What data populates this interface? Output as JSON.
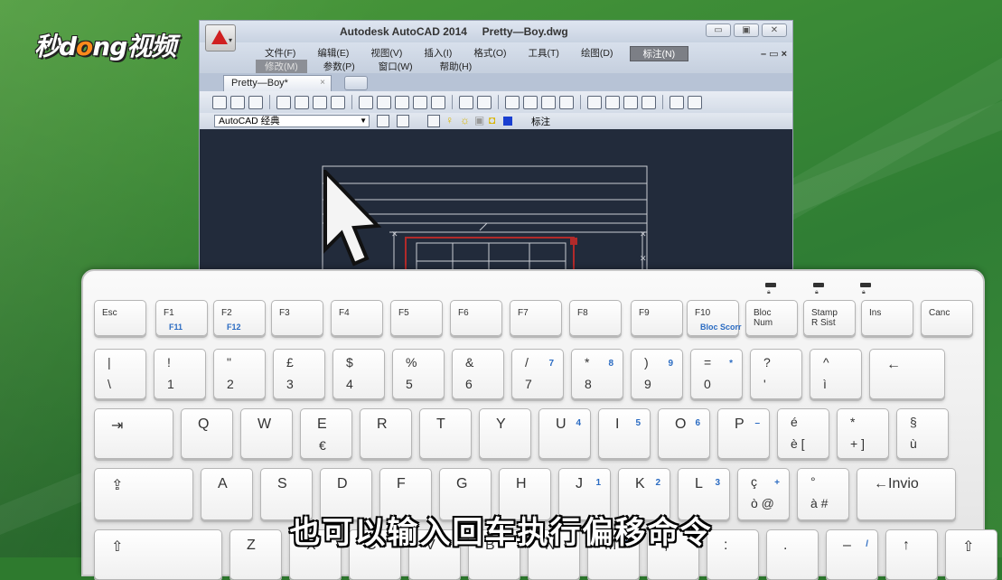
{
  "logo": {
    "text_pre": "秒d",
    "text_o": "o",
    "text_post": "ng视频"
  },
  "autocad": {
    "title": "Autodesk AutoCAD 2014     Pretty—Boy.dwg",
    "window_buttons": [
      "▭",
      "▣",
      "✕"
    ],
    "menu_row1": [
      "文件(F)",
      "编辑(E)",
      "视图(V)",
      "插入(I)",
      "格式(O)",
      "工具(T)",
      "绘图(D)",
      "标注(N)"
    ],
    "menu_row2": [
      "修改(M)",
      "参数(P)",
      "窗口(W)",
      "帮助(H)"
    ],
    "mdi_controls": "– ▭ ×",
    "doc_tab": "Pretty—Boy*",
    "doc_tab_close": "×",
    "workspace": "AutoCAD 经典",
    "layer_label": "标注"
  },
  "keyboard": {
    "row0": [
      {
        "main": "Esc"
      },
      {
        "main": "F1",
        "blue": "F11"
      },
      {
        "main": "F2",
        "blue": "F12"
      },
      {
        "main": "F3"
      },
      {
        "main": "F4"
      },
      {
        "main": "F5"
      },
      {
        "main": "F6"
      },
      {
        "main": "F7"
      },
      {
        "main": "F8"
      },
      {
        "main": "F9"
      },
      {
        "main": "F10",
        "blue": "Bloc Scorr"
      },
      {
        "main": "Bloc\nNum"
      },
      {
        "main": "Stamp\nR Sist"
      },
      {
        "main": "Ins"
      },
      {
        "main": "Canc"
      }
    ],
    "row1": [
      {
        "top": "|",
        "bottom": "\\"
      },
      {
        "top": "!",
        "bottom": "1"
      },
      {
        "top": "\"",
        "bottom": "2"
      },
      {
        "top": "£",
        "bottom": "3"
      },
      {
        "top": "$",
        "bottom": "4"
      },
      {
        "top": "%",
        "bottom": "5"
      },
      {
        "top": "&",
        "bottom": "6"
      },
      {
        "top": "/",
        "bottom": "7",
        "blue": "7"
      },
      {
        "top": "*",
        "bottom": "8",
        "blue": "8"
      },
      {
        "top": ")",
        "bottom": "9",
        "blue": "9"
      },
      {
        "top": "=",
        "bottom": "0",
        "blue": "*"
      },
      {
        "top": "?",
        "bottom": "'"
      },
      {
        "top": "^",
        "bottom": "ì"
      },
      {
        "main": "←"
      }
    ],
    "row2": [
      {
        "main": "⇥"
      },
      {
        "main": "Q"
      },
      {
        "main": "W"
      },
      {
        "main": "E",
        "sub": "€"
      },
      {
        "main": "R"
      },
      {
        "main": "T"
      },
      {
        "main": "Y"
      },
      {
        "main": "U",
        "blue": "4"
      },
      {
        "main": "I",
        "blue": "5"
      },
      {
        "main": "O",
        "blue": "6"
      },
      {
        "main": "P",
        "blue": "–"
      },
      {
        "top": "é",
        "bottom": "è  ["
      },
      {
        "top": "*",
        "bottom": "+  ]"
      },
      {
        "top": "§",
        "bottom": "ù"
      }
    ],
    "row3": [
      {
        "main": "⇪"
      },
      {
        "main": "A"
      },
      {
        "main": "S"
      },
      {
        "main": "D"
      },
      {
        "main": "F"
      },
      {
        "main": "G"
      },
      {
        "main": "H"
      },
      {
        "main": "J",
        "blue": "1"
      },
      {
        "main": "K",
        "blue": "2"
      },
      {
        "main": "L",
        "blue": "3"
      },
      {
        "top": "ç",
        "bottom": "ò  @",
        "blue": "+"
      },
      {
        "top": "°",
        "bottom": "à  #"
      },
      {
        "main": "←Invio"
      }
    ],
    "row4": [
      {
        "main": "⇧"
      },
      {
        "main": "Z"
      },
      {
        "main": "X"
      },
      {
        "main": "C"
      },
      {
        "main": "V"
      },
      {
        "main": "B"
      },
      {
        "main": "N"
      },
      {
        "main": "M",
        "blue": "0"
      },
      {
        "main": ";"
      },
      {
        "main": ":"
      },
      {
        "main": "."
      },
      {
        "main": "–",
        "blue": "/"
      },
      {
        "main": "↑"
      },
      {
        "main": "⇧"
      }
    ]
  },
  "subtitle": "也可以输入回车执行偏移命令"
}
